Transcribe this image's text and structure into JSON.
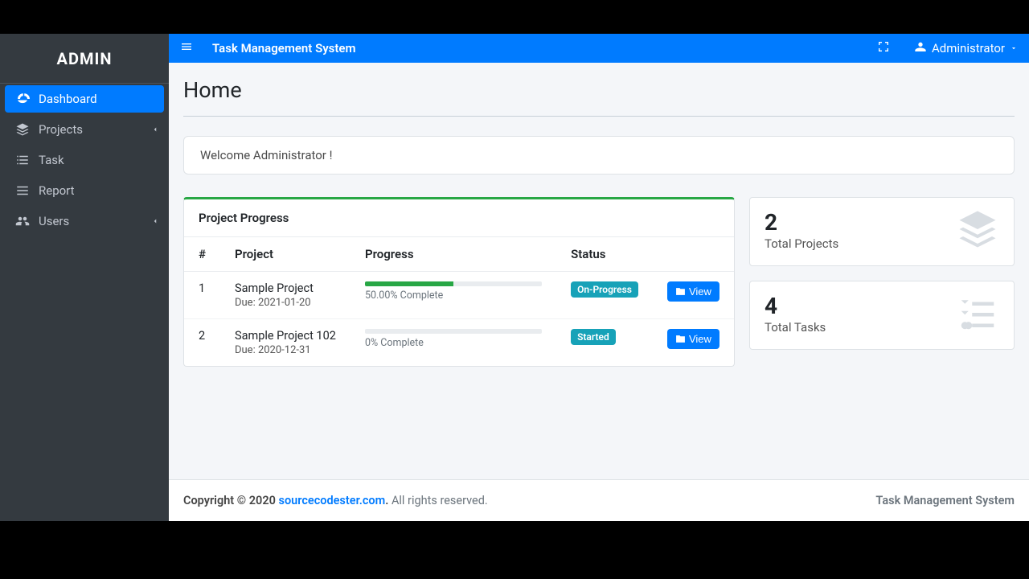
{
  "sidebar": {
    "brand": "ADMIN",
    "items": [
      {
        "label": "Dashboard"
      },
      {
        "label": "Projects"
      },
      {
        "label": "Task"
      },
      {
        "label": "Report"
      },
      {
        "label": "Users"
      }
    ]
  },
  "header": {
    "title": "Task Management System",
    "user": "Administrator"
  },
  "page": {
    "title": "Home",
    "welcome": "Welcome Administrator !"
  },
  "progress_table": {
    "title": "Project Progress",
    "columns": {
      "idx": "#",
      "project": "Project",
      "progress": "Progress",
      "status": "Status"
    },
    "rows": [
      {
        "idx": "1",
        "name": "Sample Project",
        "due_label": "Due: 2021-01-20",
        "pct": 50,
        "pct_label": "50.00% Complete",
        "status": "On-Progress",
        "status_class": "onprogress",
        "action": "View"
      },
      {
        "idx": "2",
        "name": "Sample Project 102",
        "due_label": "Due: 2020-12-31",
        "pct": 0,
        "pct_label": "0% Complete",
        "status": "Started",
        "status_class": "started",
        "action": "View"
      }
    ]
  },
  "stats": [
    {
      "value": "2",
      "label": "Total Projects"
    },
    {
      "value": "4",
      "label": "Total Tasks"
    }
  ],
  "footer": {
    "copyright_prefix": "Copyright © 2020 ",
    "link_text": "sourcecodester.com",
    "link_suffix": ".",
    "rights": " All rights reserved.",
    "right": "Task Management System"
  }
}
